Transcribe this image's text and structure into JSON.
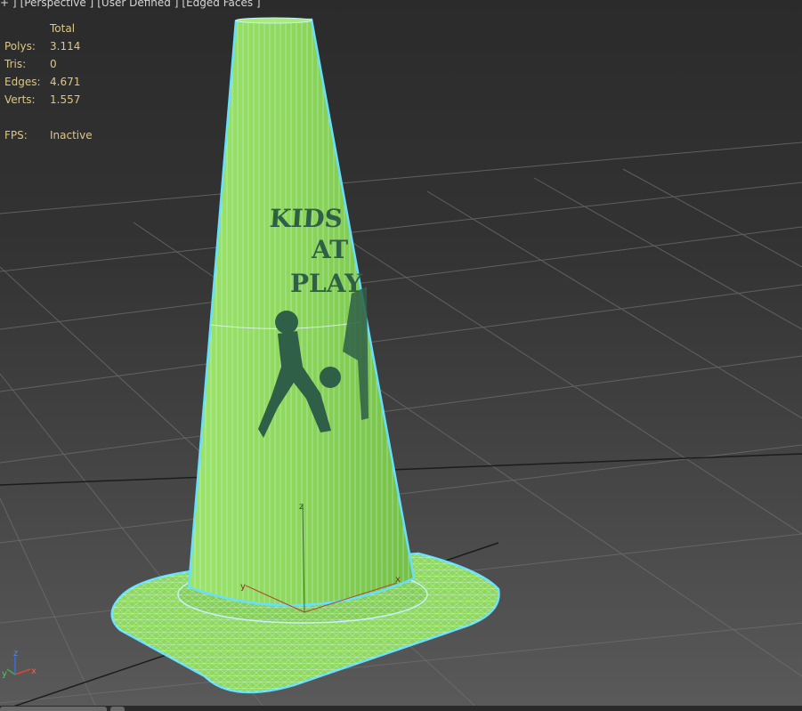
{
  "viewport": {
    "labels": [
      "+ ]",
      "[Perspective ]",
      "[User Defined ]",
      "[Edged Faces ]"
    ]
  },
  "stats": {
    "header": "Total",
    "rows": [
      {
        "key": "Polys:",
        "value": "3.114"
      },
      {
        "key": "Tris:",
        "value": "0"
      },
      {
        "key": "Edges:",
        "value": "4.671"
      },
      {
        "key": "Verts:",
        "value": "1.557"
      }
    ],
    "fps_key": "FPS:",
    "fps_value": "Inactive"
  },
  "model": {
    "decal_text": [
      "KIDS",
      "AT",
      "PLAY"
    ],
    "body_color": "#8ed85c",
    "wire_color": "#c8f0ff",
    "selection_color": "#66e0ff"
  },
  "gizmo": {
    "local_axes": [
      "z",
      "y",
      "x"
    ],
    "world_axes": [
      "z",
      "y",
      "x"
    ],
    "colors": {
      "x": "#e0452f",
      "y": "#48a84c",
      "z": "#3a6fd8"
    }
  }
}
